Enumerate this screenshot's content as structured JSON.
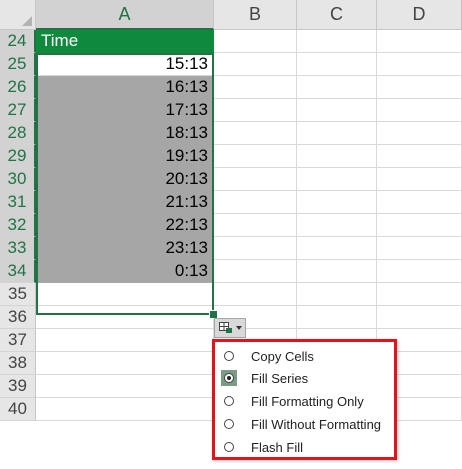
{
  "columns": [
    "A",
    "B",
    "C",
    "D"
  ],
  "rows": [
    "24",
    "25",
    "26",
    "27",
    "28",
    "29",
    "30",
    "31",
    "32",
    "33",
    "34",
    "35",
    "36",
    "37",
    "38",
    "39",
    "40"
  ],
  "header_cell": "Time",
  "times": [
    "15:13",
    "16:13",
    "17:13",
    "18:13",
    "19:13",
    "20:13",
    "21:13",
    "22:13",
    "23:13",
    "0:13"
  ],
  "autofill_menu": {
    "items": [
      {
        "label": "Copy Cells",
        "selected": false
      },
      {
        "label": "Fill Series",
        "selected": true
      },
      {
        "label": "Fill Formatting Only",
        "selected": false
      },
      {
        "label": "Fill Without Formatting",
        "selected": false
      },
      {
        "label": "Flash Fill",
        "selected": false
      }
    ]
  },
  "colors": {
    "header_green": "#0f8a3c",
    "selection_border": "#217346",
    "selection_fill": "#a6a6a6",
    "highlight_box": "#e3131c"
  },
  "icons": {
    "autofill_options": "autofill-options-icon",
    "dropdown_arrow": "chevron-down-icon"
  }
}
